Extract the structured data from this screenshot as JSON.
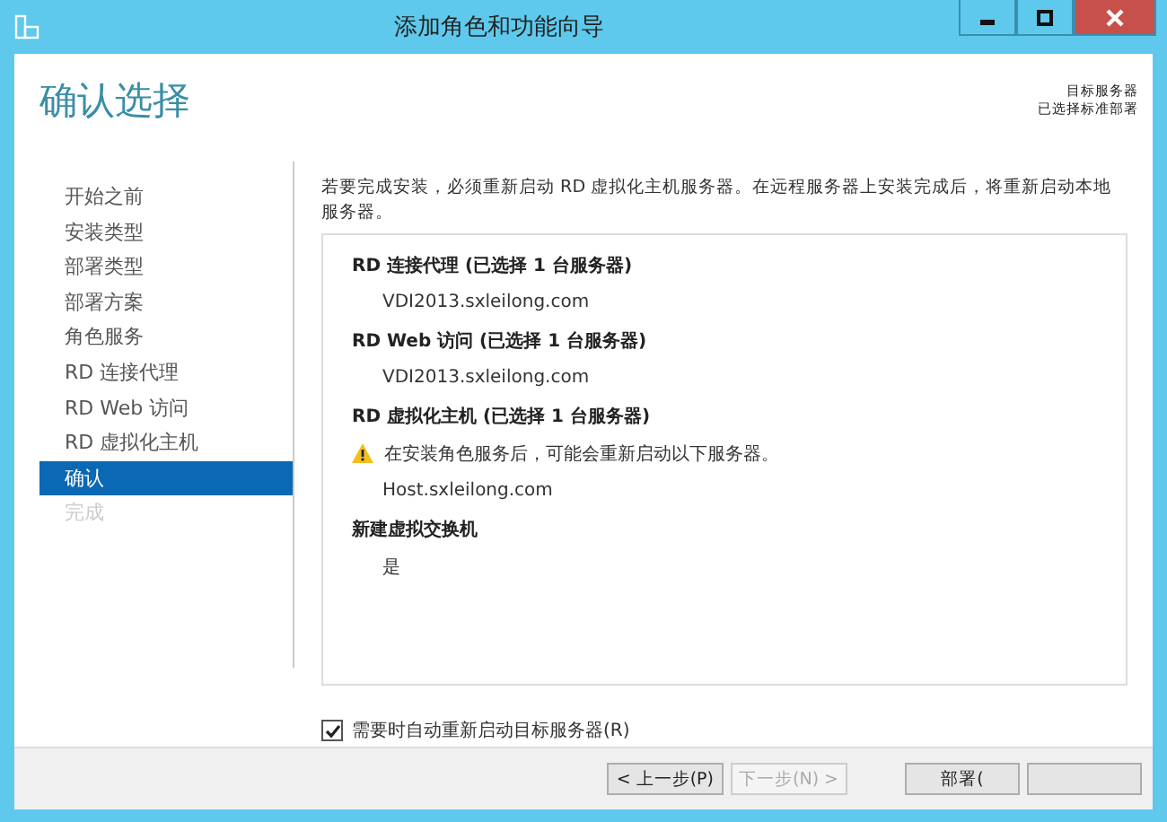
{
  "window": {
    "title": "添加角色和功能向导"
  },
  "header": {
    "title": "确认选择",
    "target_label": "目标服务器",
    "target_value": "已选择标准部署"
  },
  "nav": [
    {
      "label": "开始之前",
      "selected": false,
      "disabled": false
    },
    {
      "label": "安装类型",
      "selected": false,
      "disabled": false
    },
    {
      "label": "部署类型",
      "selected": false,
      "disabled": false
    },
    {
      "label": "部署方案",
      "selected": false,
      "disabled": false
    },
    {
      "label": "角色服务",
      "selected": false,
      "disabled": false
    },
    {
      "label": "RD 连接代理",
      "selected": false,
      "disabled": false
    },
    {
      "label": "RD Web 访问",
      "selected": false,
      "disabled": false
    },
    {
      "label": "RD 虚拟化主机",
      "selected": false,
      "disabled": false
    },
    {
      "label": "确认",
      "selected": true,
      "disabled": false
    },
    {
      "label": "完成",
      "selected": false,
      "disabled": true
    }
  ],
  "intro": "若要完成安装，必须重新启动 RD 虚拟化主机服务器。在远程服务器上安装完成后，将重新启动本地服务器。",
  "summary": [
    {
      "kind": "heading",
      "text": "RD 连接代理  (已选择 1 台服务器)"
    },
    {
      "kind": "value",
      "text": "VDI2013.sxleilong.com"
    },
    {
      "kind": "heading",
      "text": "RD Web 访问  (已选择 1 台服务器)"
    },
    {
      "kind": "value",
      "text": "VDI2013.sxleilong.com"
    },
    {
      "kind": "heading",
      "text": "RD 虚拟化主机  (已选择 1 台服务器)"
    },
    {
      "kind": "warning",
      "text": "在安装角色服务后，可能会重新启动以下服务器。"
    },
    {
      "kind": "value",
      "text": "Host.sxleilong.com"
    },
    {
      "kind": "heading",
      "text": "新建虚拟交换机"
    },
    {
      "kind": "value",
      "text": "是"
    }
  ],
  "restart_option": {
    "label": "需要时自动重新启动目标服务器(R)",
    "checked": true
  },
  "buttons": [
    {
      "label": "< 上一步(P)",
      "disabled": false
    },
    {
      "label": "下一步(N) >",
      "disabled": true
    },
    {
      "label": "部署(",
      "disabled": false
    },
    {
      "disabled": false
    }
  ]
}
